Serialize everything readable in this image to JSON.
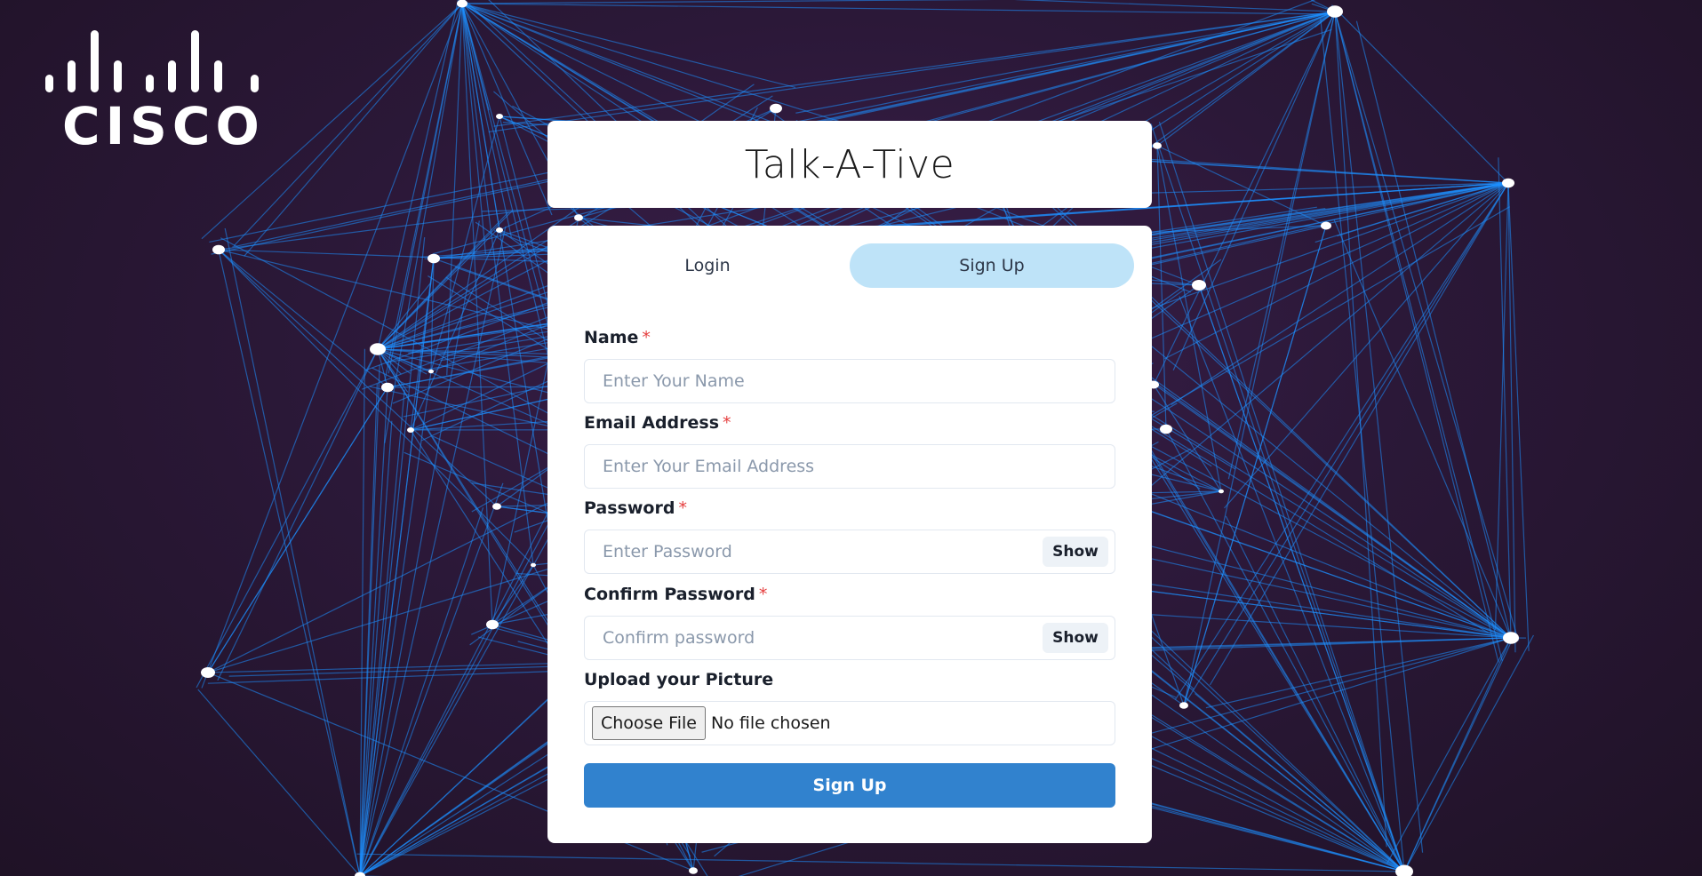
{
  "brand": {
    "logo_text": "CISCO"
  },
  "app": {
    "title": "Talk-A-Tive"
  },
  "tabs": [
    {
      "label": "Login",
      "active": false
    },
    {
      "label": "Sign Up",
      "active": true
    }
  ],
  "form": {
    "name": {
      "label": "Name",
      "required_mark": "*",
      "placeholder": "Enter Your Name"
    },
    "email": {
      "label": "Email Address",
      "required_mark": "*",
      "placeholder": "Enter Your Email Address"
    },
    "password": {
      "label": "Password",
      "required_mark": "*",
      "placeholder": "Enter Password",
      "show_label": "Show"
    },
    "confirm": {
      "label": "Confirm Password",
      "required_mark": "*",
      "placeholder": "Confirm password",
      "show_label": "Show"
    },
    "picture": {
      "label": "Upload your Picture",
      "button_label": "Choose File",
      "status": "No file chosen"
    },
    "submit_label": "Sign Up"
  },
  "colors": {
    "background": "#2b1838",
    "network_line": "#1e90ff",
    "active_tab": "#bee3f8",
    "primary_button": "#3182ce",
    "required": "#e53e3e"
  }
}
